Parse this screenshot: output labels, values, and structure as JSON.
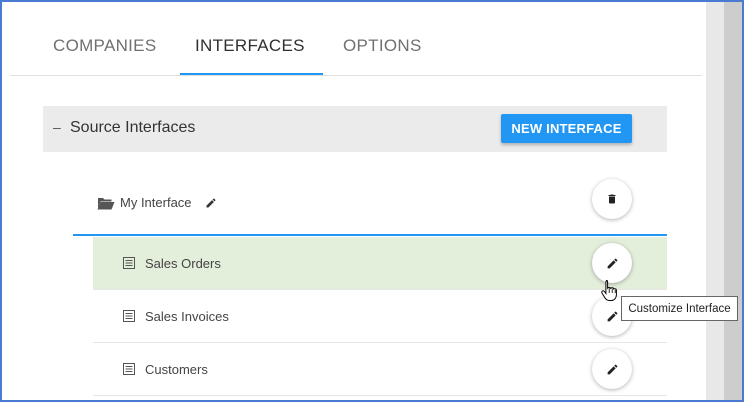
{
  "tabs": [
    {
      "label": "COMPANIES",
      "active": false
    },
    {
      "label": "INTERFACES",
      "active": true
    },
    {
      "label": "OPTIONS",
      "active": false
    }
  ],
  "accent_color": "#2196f3",
  "section": {
    "toggle": "–",
    "title": "Source Interfaces",
    "new_button_label": "NEW INTERFACE"
  },
  "folder": {
    "label": "My Interface",
    "icon": "folder-open-icon",
    "action_icon": "delete-icon"
  },
  "items": [
    {
      "label": "Sales Orders",
      "icon": "document-list-icon",
      "action_icon": "edit-icon",
      "selected": true
    },
    {
      "label": "Sales Invoices",
      "icon": "document-list-icon",
      "action_icon": "edit-icon",
      "selected": false
    },
    {
      "label": "Customers",
      "icon": "document-list-icon",
      "action_icon": "edit-icon",
      "selected": false
    }
  ],
  "tooltip": "Customize Interface",
  "selected_row_color": "#e3eedb"
}
